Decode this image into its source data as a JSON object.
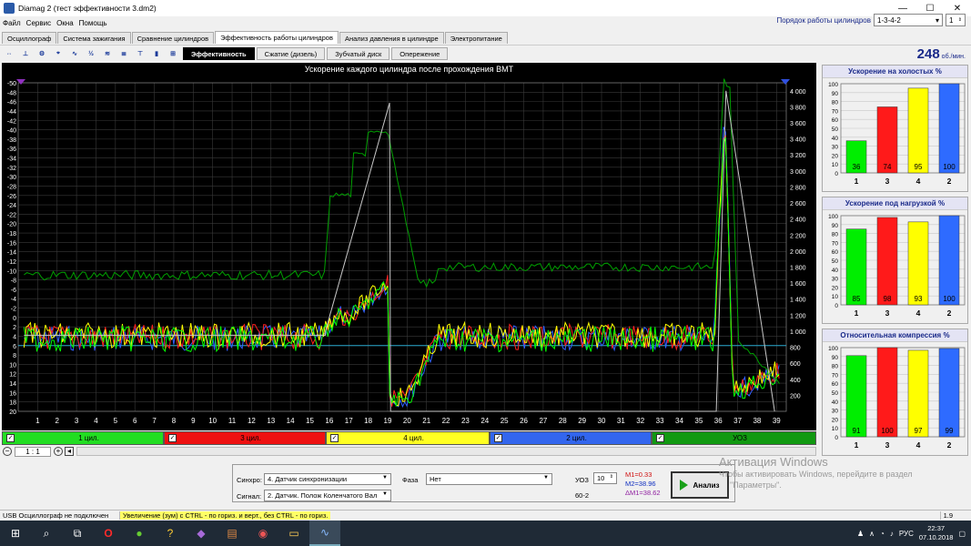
{
  "window": {
    "title": "Diamag 2 (тест эффективности 3.dm2)"
  },
  "menu": [
    "Файл",
    "Сервис",
    "Окна",
    "Помощь"
  ],
  "cylinder_order": {
    "label": "Порядок работы цилиндров",
    "value": "1-3-4-2",
    "spin": "1"
  },
  "tabs": [
    {
      "label": "Осциллограф",
      "active": false
    },
    {
      "label": "Система зажигания",
      "active": false
    },
    {
      "label": "Сравнение цилиндров",
      "active": false
    },
    {
      "label": "Эффективность работы цилиндров",
      "active": true
    },
    {
      "label": "Анализ давления в цилиндре",
      "active": false
    },
    {
      "label": "Электропитание",
      "active": false
    }
  ],
  "subtabs": [
    {
      "label": "Эффективность",
      "active": true
    },
    {
      "label": "Сжатие (дизель)",
      "active": false
    },
    {
      "label": "Зубчатый диск",
      "active": false
    },
    {
      "label": "Опережение",
      "active": false
    }
  ],
  "rpm": {
    "value": "248",
    "unit": "об./мин."
  },
  "chart_data": [
    {
      "type": "line",
      "title": "Ускорение каждого цилиндра после прохождения ВМТ",
      "x": [
        1,
        2,
        3,
        4,
        5,
        6,
        7,
        8,
        9,
        10,
        11,
        12,
        13,
        14,
        15,
        16,
        17,
        18,
        19,
        20,
        21,
        22,
        23,
        24,
        25,
        26,
        27,
        28,
        29,
        30,
        31,
        32,
        33,
        34,
        35,
        36,
        37,
        38,
        39
      ],
      "left_axis": {
        "ticks": [
          -50,
          -48,
          -46,
          -44,
          -42,
          -40,
          -38,
          -36,
          -34,
          -32,
          -30,
          -28,
          -26,
          -24,
          -22,
          -20,
          -18,
          -16,
          -14,
          -12,
          -10,
          -8,
          -6,
          -4,
          -2,
          0,
          2,
          4,
          6,
          8,
          10,
          12,
          14,
          16,
          18,
          20
        ],
        "ylim": [
          -50,
          20
        ],
        "inverted": true
      },
      "right_axis": {
        "ticks": [
          200,
          400,
          600,
          800,
          1000,
          1200,
          1400,
          1600,
          1800,
          2000,
          2200,
          2400,
          2600,
          2800,
          3000,
          3200,
          3400,
          3600,
          3800,
          4000
        ],
        "ylim": [
          0,
          4100
        ]
      },
      "series": [
        {
          "name": "1 цил.",
          "color": "#00ff00"
        },
        {
          "name": "3 цил.",
          "color": "#ff2020"
        },
        {
          "name": "4 цил.",
          "color": "#ffff00"
        },
        {
          "name": "2 цил.",
          "color": "#3060ff"
        },
        {
          "name": "УОЗ",
          "color": "#00a000"
        }
      ],
      "grid": true
    },
    {
      "type": "bar",
      "title": "Ускорение на холостых %",
      "categories": [
        "1",
        "3",
        "4",
        "2"
      ],
      "values": [
        36,
        74,
        95,
        100
      ],
      "ylim": [
        0,
        100
      ]
    },
    {
      "type": "bar",
      "title": "Ускорение под нагрузкой %",
      "categories": [
        "1",
        "3",
        "4",
        "2"
      ],
      "values": [
        85,
        98,
        93,
        100
      ],
      "ylim": [
        0,
        100
      ]
    },
    {
      "type": "bar",
      "title": "Относительная компрессия %",
      "categories": [
        "1",
        "3",
        "4",
        "2"
      ],
      "values": [
        91,
        100,
        97,
        99
      ],
      "ylim": [
        0,
        100
      ]
    }
  ],
  "bar_colors": [
    "#00ee00",
    "#ff1a1a",
    "#ffff00",
    "#2e6bff"
  ],
  "channels": [
    {
      "label": "1 цил.",
      "color": "#22dd22"
    },
    {
      "label": "3 цил.",
      "color": "#ee1111"
    },
    {
      "label": "4 цил.",
      "color": "#ffff22"
    },
    {
      "label": "2 цил.",
      "color": "#3366ee"
    },
    {
      "label": "УОЗ",
      "color": "#119911"
    }
  ],
  "zoom": {
    "label": "1 : 1"
  },
  "controls": {
    "sync_label": "Синхро:",
    "sync_value": "4.  Датчик синхронизации",
    "signal_label": "Сигнал:",
    "signal_value": "2.  Датчик. Полож Коленчатого Вал",
    "phase_label": "Фаза",
    "phase_value": "Нет",
    "uoz_label": "УОЗ",
    "uoz_value": "10",
    "teeth": "60-2",
    "m1": "M1=0.33",
    "m2": "M2=38.96",
    "dm": "ΔM1=38.62",
    "analyze": "Анализ"
  },
  "watermark": {
    "line1": "Активация Windows",
    "line2": "Чтобы активировать Windows, перейдите в раздел",
    "line3": "\"Параметры\"."
  },
  "status": {
    "usb": "USB Осциллограф не подключен",
    "hint": "Увеличение (зум) с CTRL - по гориз. и верт., без CTRL - по гориз.",
    "version": "1.9"
  },
  "tray": {
    "lang": "РУС",
    "time": "22:37",
    "date": "07.10.2018"
  }
}
